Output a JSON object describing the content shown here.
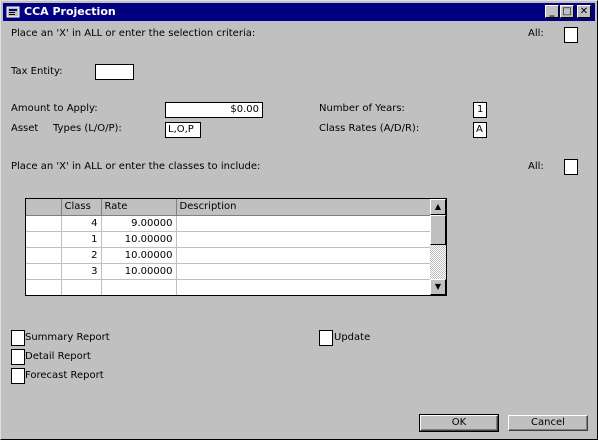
{
  "window": {
    "title": "CCA Projection",
    "controls": {
      "minimize": "_",
      "maximize": "□",
      "close": "✕"
    }
  },
  "selection": {
    "prompt": "Place an 'X' in ALL or enter the selection criteria:",
    "all_label": "All:",
    "all_value": ""
  },
  "tax_entity": {
    "label": "Tax Entity:",
    "value": ""
  },
  "amount": {
    "label": "Amount to Apply:",
    "value": "$0.00"
  },
  "asset_types": {
    "label_part1": "Asset",
    "label_part2": "Types (L/O/P):",
    "value": "L,O,P"
  },
  "years": {
    "label": "Number of Years:",
    "value": "1"
  },
  "class_rates": {
    "label": "Class Rates (A/D/R):",
    "value": "A"
  },
  "classes": {
    "prompt": "Place an 'X' in ALL or enter the classes to include:",
    "all_label": "All:",
    "all_value": ""
  },
  "grid": {
    "columns": [
      "",
      "Class",
      "Rate",
      "Description"
    ],
    "rows": [
      {
        "class": "4",
        "rate": "9.00000",
        "description": ""
      },
      {
        "class": "1",
        "rate": "10.00000",
        "description": ""
      },
      {
        "class": "2",
        "rate": "10.00000",
        "description": ""
      },
      {
        "class": "3",
        "rate": "10.00000",
        "description": ""
      },
      {
        "class": "",
        "rate": "",
        "description": ""
      }
    ]
  },
  "reports": {
    "summary": "Summary Report",
    "detail": "Detail Report",
    "forecast": "Forecast Report",
    "update": "Update"
  },
  "buttons": {
    "ok": "OK",
    "cancel": "Cancel"
  }
}
